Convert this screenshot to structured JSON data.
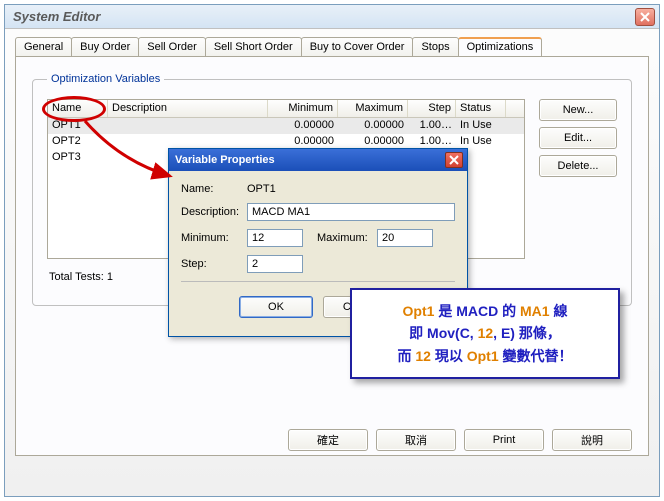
{
  "window_title": "System Editor",
  "tabs": [
    "General",
    "Buy Order",
    "Sell Order",
    "Sell Short Order",
    "Buy to Cover Order",
    "Stops",
    "Optimizations"
  ],
  "active_tab": 6,
  "group_label": "Optimization Variables",
  "columns": {
    "name": "Name",
    "desc": "Description",
    "min": "Minimum",
    "max": "Maximum",
    "step": "Step",
    "status": "Status"
  },
  "rows": [
    {
      "name": "OPT1",
      "desc": "",
      "min": "0.00000",
      "max": "0.00000",
      "step": "1.00…",
      "status": "In Use",
      "sel": true
    },
    {
      "name": "OPT2",
      "desc": "",
      "min": "0.00000",
      "max": "0.00000",
      "step": "1.00…",
      "status": "In Use",
      "sel": false
    },
    {
      "name": "OPT3",
      "desc": "",
      "min": "",
      "max": "",
      "step": "",
      "status": "",
      "sel": false
    }
  ],
  "side": {
    "new": "New...",
    "edit": "Edit...",
    "del": "Delete..."
  },
  "totals": "Total Tests: 1",
  "bottom": {
    "ok": "確定",
    "cancel": "取消",
    "print": "Print",
    "help": "說明"
  },
  "dialog": {
    "title": "Variable Properties",
    "name_lbl": "Name:",
    "name_val": "OPT1",
    "desc_lbl": "Description:",
    "desc_val": "MACD MA1",
    "min_lbl": "Minimum:",
    "min_val": "12",
    "max_lbl": "Maximum:",
    "max_val": "20",
    "step_lbl": "Step:",
    "step_val": "2",
    "ok": "OK",
    "cancel": "Cancel"
  },
  "note": {
    "l1a": "Opt1",
    "l1b": " 是 MACD 的 ",
    "l1c": "MA1",
    "l1d": " 線",
    "l2a": "即 Mov(C, ",
    "l2b": "12",
    "l2c": ", E) 那條，",
    "l3a": "而 ",
    "l3b": "12",
    "l3c": " 現以 ",
    "l3d": "Opt1",
    "l3e": " 變數代替！"
  }
}
